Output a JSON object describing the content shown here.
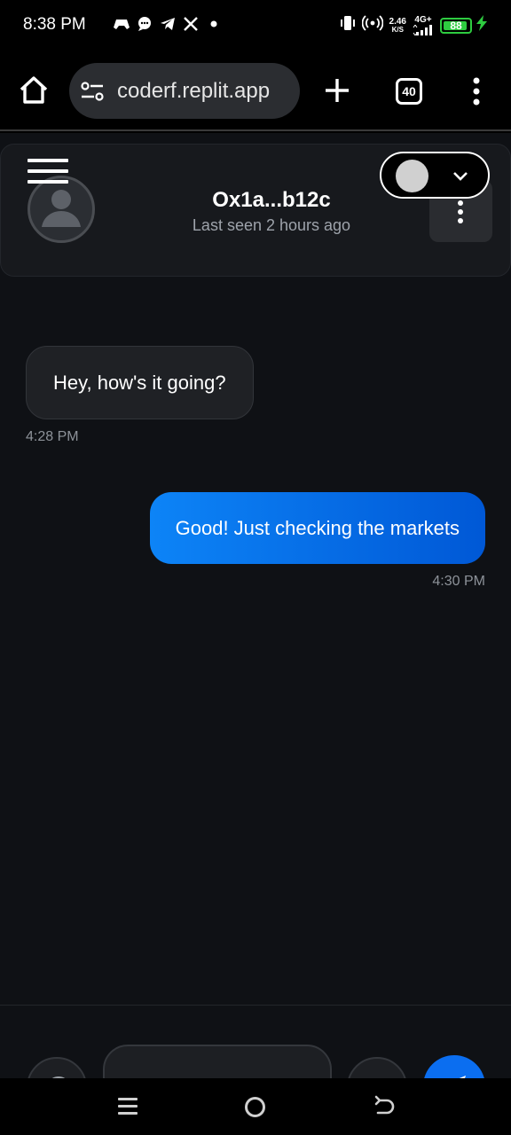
{
  "status_bar": {
    "time": "8:38 PM",
    "left_icons": [
      "game-controller-icon",
      "chat-bubble-icon",
      "telegram-icon",
      "x-logo-icon",
      "dot-icon"
    ],
    "net_speed_value": "2.46",
    "net_speed_unit": "K/S",
    "network_type": "4G+",
    "battery_level": "88",
    "colors": {
      "battery": "#2ecc40"
    }
  },
  "browser": {
    "url": "coderf.replit.app",
    "tab_count": "40"
  },
  "chat": {
    "contact_name": "Ox1a...b12c",
    "last_seen": "Last seen 2 hours ago",
    "messages": [
      {
        "direction": "incoming",
        "text": "Hey, how's it going?",
        "time": "4:28 PM"
      },
      {
        "direction": "outgoing",
        "text": "Good! Just checking the markets",
        "time": "4:30 PM"
      }
    ],
    "composer": {
      "value": "",
      "placeholder": ""
    },
    "colors": {
      "background": "#0f1115",
      "outgoing_bubble": "#0b6ef0",
      "incoming_bubble": "#1f2125"
    }
  }
}
